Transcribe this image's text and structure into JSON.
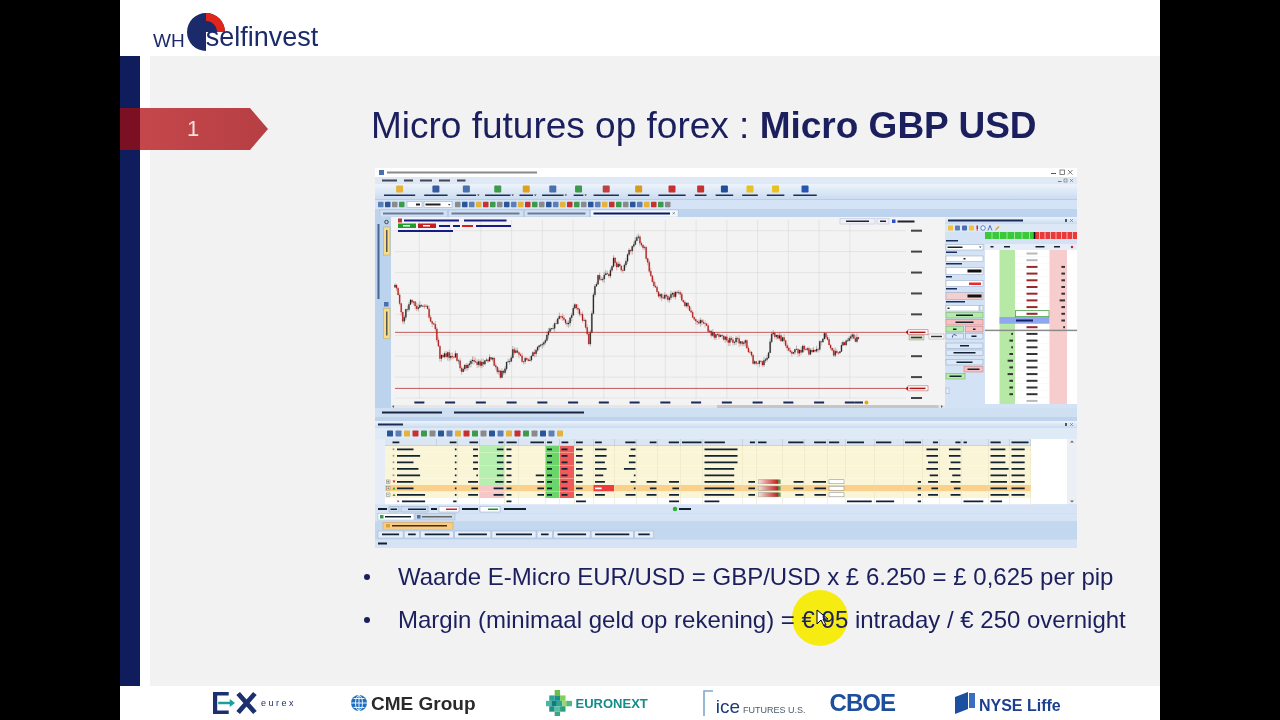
{
  "logo": {
    "prefix": "WH",
    "name": "selfinvest"
  },
  "slide": {
    "number": "1",
    "title": "Micro futures op forex : **Micro GBP USD**"
  },
  "bullets": [
    "Waarde E-Micro EUR/USD = GBP/USD x £ 6.250 = £ 0,625 per pip",
    "Margin (minimaal geld op rekening) = € 95 intraday / € 250 overnight"
  ],
  "pointer": {
    "highlighted": true
  },
  "exchange_logos": [
    {
      "kind": "eurex",
      "text": "eurex"
    },
    {
      "kind": "cme",
      "text": "CME Group"
    },
    {
      "kind": "euronext",
      "text": "EURONEXT"
    },
    {
      "kind": "ice",
      "text": "ice",
      "subtext": "FUTURES U.S."
    },
    {
      "kind": "cboe",
      "text": "CBOE"
    },
    {
      "kind": "nyse",
      "text": "NYSE Liffe"
    }
  ]
}
